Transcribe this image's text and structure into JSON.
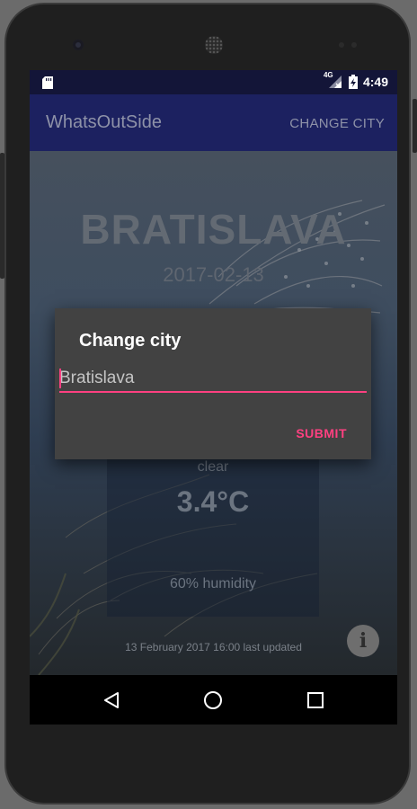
{
  "status_bar": {
    "network": "4G",
    "time": "4:49"
  },
  "app_bar": {
    "title": "WhatsOutSide",
    "change_city_label": "CHANGE CITY"
  },
  "weather": {
    "city": "BRATISLAVA",
    "date": "2017-02-13",
    "description": "clear",
    "temperature": "3.4°C",
    "humidity": "60% humidity",
    "last_updated": "13 February 2017 16:00 last updated"
  },
  "dialog": {
    "title": "Change city",
    "input_value": "Bratislava",
    "submit_label": "SUBMIT"
  },
  "icons": {
    "info": "info-icon",
    "back": "back-icon",
    "home": "home-icon",
    "recents": "recents-icon"
  },
  "colors": {
    "accent": "#ff4081",
    "app_bar": "#1c2160",
    "status_bar": "#131538",
    "dialog_bg": "#424242"
  }
}
